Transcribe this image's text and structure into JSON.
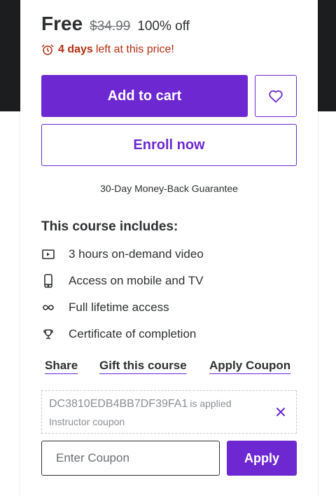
{
  "price": {
    "current": "Free",
    "original": "$34.99",
    "discount": "100% off"
  },
  "urgency": {
    "icon": "alarm-clock-icon",
    "bold": "4 days",
    "text": "left at this price!",
    "color": "#b32d0f"
  },
  "actions": {
    "add_to_cart": "Add to cart",
    "wishlist_icon": "heart-icon",
    "enroll_now": "Enroll now",
    "guarantee": "30-Day Money-Back Guarantee"
  },
  "includes": {
    "title": "This course includes:",
    "items": [
      {
        "icon": "video-icon",
        "label": "3 hours on-demand video"
      },
      {
        "icon": "mobile-icon",
        "label": "Access on mobile and TV"
      },
      {
        "icon": "infinity-icon",
        "label": "Full lifetime access"
      },
      {
        "icon": "trophy-icon",
        "label": "Certificate of completion"
      }
    ]
  },
  "links": {
    "share": "Share",
    "gift": "Gift this course",
    "apply_coupon": "Apply Coupon"
  },
  "coupon": {
    "code": "DC3810EDB4BB7DF39FA1",
    "status": "is applied",
    "type": "Instructor coupon",
    "remove_icon": "close-icon",
    "input_placeholder": "Enter Coupon",
    "apply_label": "Apply"
  },
  "colors": {
    "accent": "#6d28d2",
    "dark_band": "#1c1d1f",
    "text": "#2d2f31",
    "muted": "#8a8f94"
  }
}
